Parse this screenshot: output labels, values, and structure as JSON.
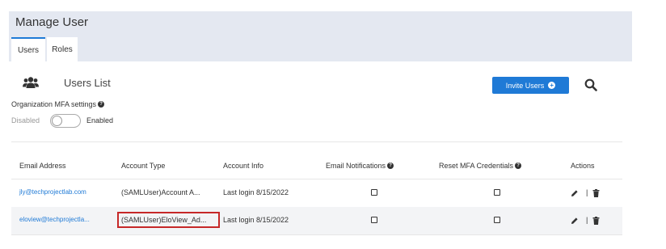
{
  "page": {
    "title": "Manage User"
  },
  "tabs": [
    {
      "label": "Users",
      "active": true
    },
    {
      "label": "Roles",
      "active": false
    }
  ],
  "list": {
    "title": "Users List"
  },
  "toolbar": {
    "invite_label": "Invite Users"
  },
  "mfa": {
    "label": "Organization MFA settings",
    "off_label": "Disabled",
    "on_label": "Enabled",
    "enabled": false
  },
  "table": {
    "headers": [
      "Email Address",
      "Account Type",
      "Account Info",
      "Email Notifications",
      "Reset MFA Credentials",
      "Actions"
    ],
    "rows": [
      {
        "email": "jly@techprojectlab.com",
        "account_type": "(SAMLUser)Account A...",
        "account_info": "Last login 8/15/2022",
        "email_notifications": false,
        "reset_mfa": false,
        "separator": "|"
      },
      {
        "email": "eloview@techprojectla...",
        "account_type": "(SAMLUser)EloView_Ad...",
        "account_info": "Last login 8/15/2022",
        "email_notifications": false,
        "reset_mfa": false,
        "separator": "|"
      }
    ]
  },
  "colors": {
    "accent": "#1f7ad6",
    "header_band": "#e4e8f1",
    "highlight": "#c62828"
  },
  "icons": [
    "users-group-icon",
    "search-icon",
    "plus-circle-icon",
    "help-icon",
    "pencil-icon",
    "trash-icon"
  ]
}
